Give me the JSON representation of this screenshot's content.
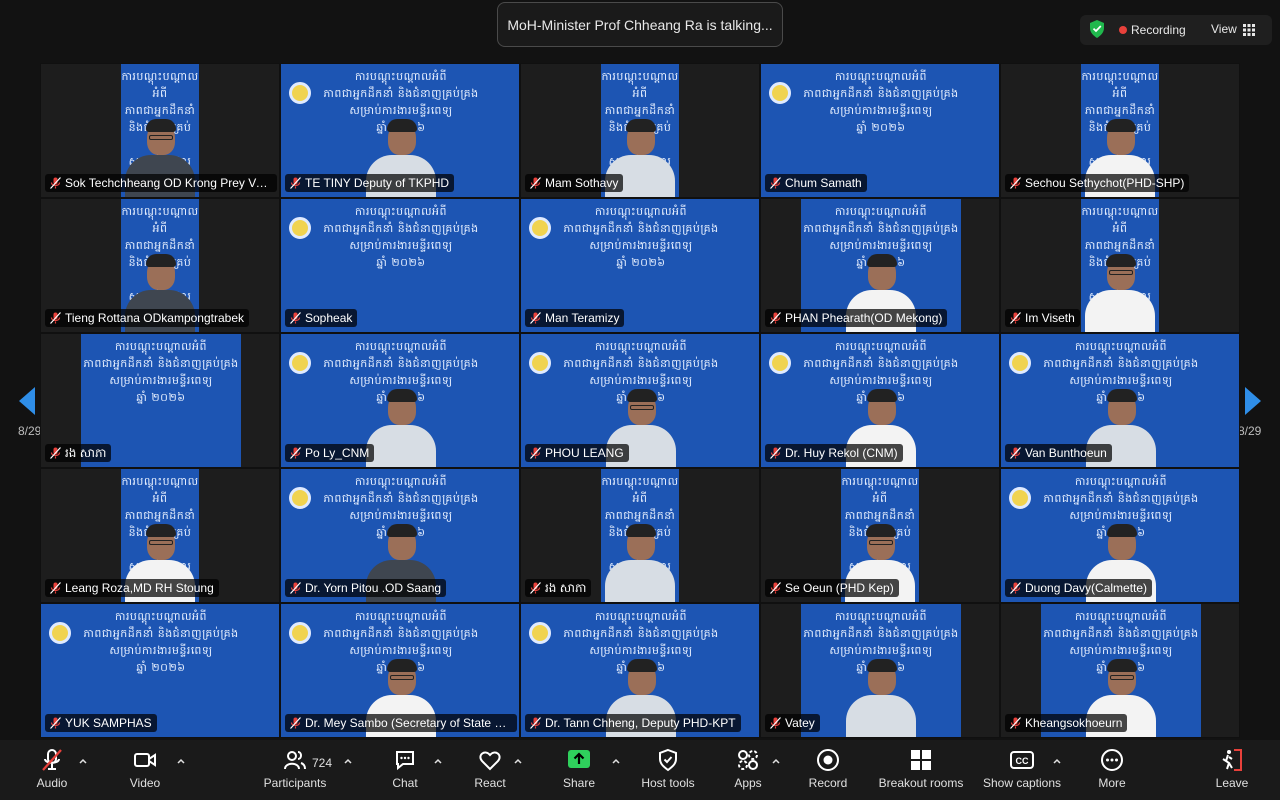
{
  "speaker_notice": "MoH-Minister Prof Chheang Ra is talking...",
  "topbar": {
    "recording_label": "Recording",
    "view_label": "View"
  },
  "pagination": {
    "left": "8/29",
    "right": "8/29"
  },
  "banner": {
    "lines": [
      "ការបណ្ដុះបណ្ដាលអំពី",
      "ភាពជាអ្នកដឹកនាំ និងជំនាញគ្រប់គ្រង",
      "សម្រាប់ការងារមន្ទីរពេទ្យ",
      "ឆ្នាំ ២០២៦"
    ]
  },
  "participants": [
    {
      "name": "Sok Techchheang OD Krong Prey Ve...",
      "video": "narrow",
      "outfit": "dark"
    },
    {
      "name": "TE TINY Deputy of TKPHD",
      "video": "full",
      "outfit": "light"
    },
    {
      "name": "Mam Sothavy",
      "video": "narrow",
      "outfit": "light"
    },
    {
      "name": "Chum Samath",
      "video": "full",
      "outfit": "none"
    },
    {
      "name": "Sechou Sethychot(PHD-SHP)",
      "video": "narrow",
      "outfit": "white"
    },
    {
      "name": "Tieng Rottana ODkampongtrabek",
      "video": "narrow",
      "outfit": "dark"
    },
    {
      "name": "Sopheak",
      "video": "full",
      "outfit": "none"
    },
    {
      "name": "Man Teramizy",
      "video": "full",
      "outfit": "none"
    },
    {
      "name": "PHAN Phearath(OD Mekong)",
      "video": "mid",
      "outfit": "white"
    },
    {
      "name": "Im Viseth",
      "video": "narrow",
      "outfit": "white"
    },
    {
      "name": "រង សាភា",
      "video": "mid",
      "outfit": "none"
    },
    {
      "name": "Po Ly_CNM",
      "video": "full",
      "outfit": "light"
    },
    {
      "name": "PHOU LEANG",
      "video": "full",
      "outfit": "light"
    },
    {
      "name": "Dr. Huy Rekol (CNM)",
      "video": "full",
      "outfit": "white"
    },
    {
      "name": "Van Bunthoeun",
      "video": "full",
      "outfit": "light"
    },
    {
      "name": "Leang Roza,MD RH Stoung",
      "video": "narrow",
      "outfit": "white"
    },
    {
      "name": "Dr. Yorn Pitou .OD Saang",
      "video": "full",
      "outfit": "dark"
    },
    {
      "name": "រង សាភា",
      "video": "narrow",
      "outfit": "light"
    },
    {
      "name": "Se Oeun (PHD Kep)",
      "video": "narrow",
      "outfit": "white"
    },
    {
      "name": "Duong Davy(Calmette)",
      "video": "full",
      "outfit": "white"
    },
    {
      "name": "YUK SAMPHAS",
      "video": "full",
      "outfit": "none"
    },
    {
      "name": "Dr. Mey Sambo (Secretary of State M...",
      "video": "full",
      "outfit": "white"
    },
    {
      "name": "Dr. Tann Chheng, Deputy PHD-KPT",
      "video": "full",
      "outfit": "light"
    },
    {
      "name": "Vatey",
      "video": "mid",
      "outfit": "light"
    },
    {
      "name": "Kheangsokhoeurn",
      "video": "mid",
      "outfit": "white"
    }
  ],
  "toolbar": {
    "audio": "Audio",
    "video": "Video",
    "participants": "Participants",
    "participant_count": "724",
    "chat": "Chat",
    "react": "React",
    "share": "Share",
    "host_tools": "Host tools",
    "apps": "Apps",
    "record": "Record",
    "breakout_rooms": "Breakout rooms",
    "show_captions": "Show captions",
    "more": "More",
    "leave": "Leave"
  },
  "colors": {
    "banner_blue": "#1d55b3",
    "share_green": "#2fd05c",
    "record_red": "#e8413b"
  }
}
